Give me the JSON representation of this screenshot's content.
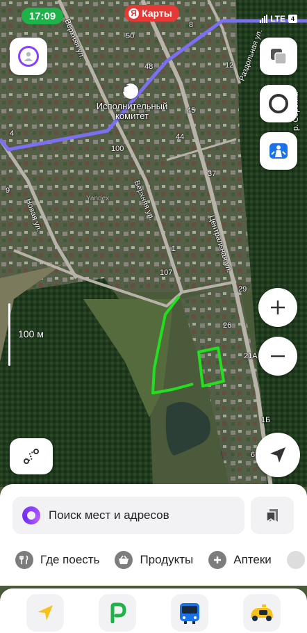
{
  "status_bar": {
    "time": "17:09",
    "network": "LTE",
    "battery": "4"
  },
  "app": {
    "brand_logo_letter": "Я",
    "brand_name": "Карты"
  },
  "map": {
    "poi_name": "Исполнительный комитет",
    "watermark": "Yandex",
    "house_numbers": [
      "50",
      "8",
      "48",
      "12",
      "45",
      "44",
      "100",
      "37",
      "1",
      "9",
      "107",
      "29",
      "26",
      "21А",
      "1Б",
      "6",
      "4"
    ],
    "street_names": [
      "Верхняя ул.",
      "Верхняя ул.",
      "Центральная ул.",
      "Новая ул.",
      "Раздольная ул.",
      "р. Соронка"
    ],
    "scale_label": "100 м",
    "route_color": "#7b6ff2",
    "drawing_color": "#22e01f"
  },
  "sheet": {
    "search_placeholder": "Поиск мест и адресов",
    "categories": [
      {
        "label": "Где поесть",
        "icon": "fork-knife-icon"
      },
      {
        "label": "Продукты",
        "icon": "basket-icon"
      },
      {
        "label": "Аптеки",
        "icon": "plus-icon"
      }
    ]
  },
  "bottom_nav": {
    "items": [
      {
        "icon": "navigator-arrow-icon",
        "color": "#f6c21a"
      },
      {
        "icon": "parking-icon",
        "color": "#1fb24a"
      },
      {
        "icon": "bus-icon",
        "color": "#1a73e8"
      },
      {
        "icon": "taxi-icon",
        "color": "#f6c21a"
      }
    ]
  }
}
